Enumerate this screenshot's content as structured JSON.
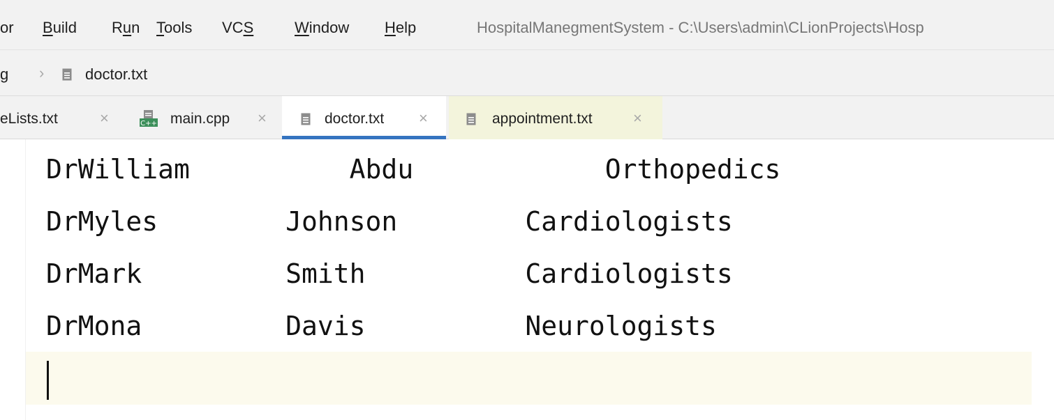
{
  "menu": {
    "items": [
      {
        "pre": "",
        "u": "",
        "post": "or"
      },
      {
        "pre": "",
        "u": "B",
        "post": "uild"
      },
      {
        "pre": "R",
        "u": "u",
        "post": "n"
      },
      {
        "pre": "",
        "u": "T",
        "post": "ools"
      },
      {
        "pre": "VC",
        "u": "S",
        "post": ""
      },
      {
        "pre": "",
        "u": "W",
        "post": "indow"
      },
      {
        "pre": "",
        "u": "H",
        "post": "elp"
      }
    ],
    "window_title": "HospitalManegmentSystem - C:\\Users\\admin\\CLionProjects\\Hosp"
  },
  "breadcrumb": {
    "parent_fragment": "g",
    "file": "doctor.txt"
  },
  "tabs": [
    {
      "label": "eLists.txt",
      "icon": "text-file-icon"
    },
    {
      "label": "main.cpp",
      "icon": "cpp-file-icon"
    },
    {
      "label": "doctor.txt",
      "icon": "text-file-icon",
      "active": true
    },
    {
      "label": "appointment.txt",
      "icon": "text-file-icon"
    }
  ],
  "tab_close_glyph": "×",
  "editor": {
    "lines": [
      "DrWilliam          Abdu            Orthopedics",
      "DrMyles        Johnson        Cardiologists",
      "DrMark         Smith          Cardiologists",
      "DrMona         Davis          Neurologists"
    ]
  },
  "colors": {
    "active_tab_underline": "#3574c0",
    "current_line_highlight": "#fcfaed",
    "modified_tab_background": "#f3f4dc"
  }
}
